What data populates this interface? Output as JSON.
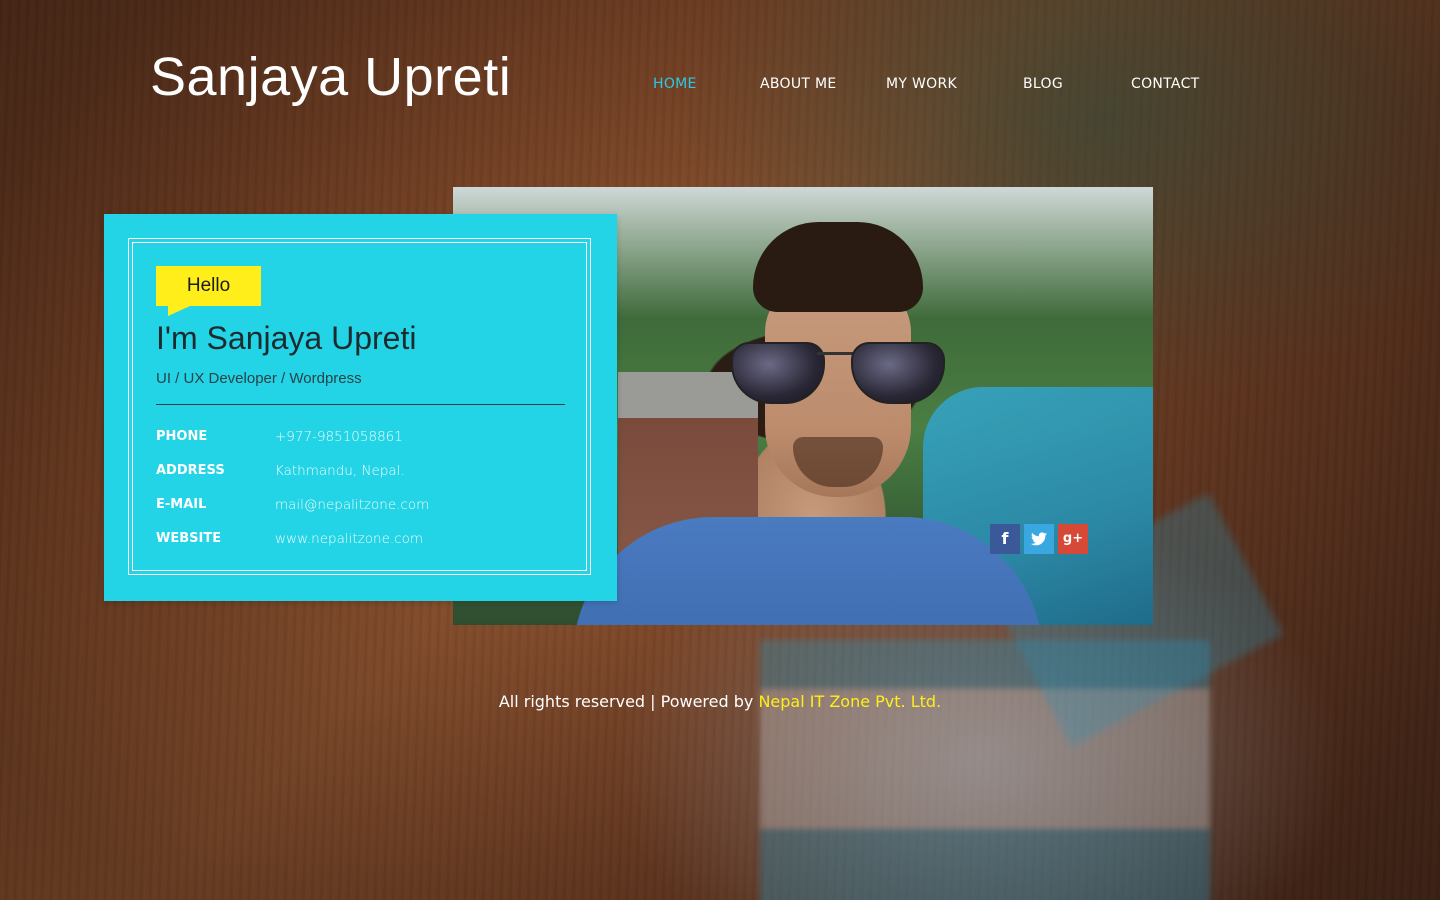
{
  "site": {
    "title": "Sanjaya Upreti"
  },
  "nav": {
    "items": [
      {
        "label": "HOME",
        "active": true
      },
      {
        "label": "ABOUT ME",
        "active": false
      },
      {
        "label": "MY WORK",
        "active": false
      },
      {
        "label": "BLOG",
        "active": false
      },
      {
        "label": "CONTACT",
        "active": false
      }
    ]
  },
  "profile": {
    "greeting": "Hello",
    "name": "I'm Sanjaya Upreti",
    "role": "UI / UX Developer / Wordpress",
    "info": [
      {
        "label": "PHONE",
        "value": "+977-9851058861"
      },
      {
        "label": "ADDRESS",
        "value": "Kathmandu, Nepal."
      },
      {
        "label": "E-MAIL",
        "value": "mail@nepalitzone.com"
      },
      {
        "label": "WEBSITE",
        "value": "www.nepalitzone.com"
      }
    ]
  },
  "social": {
    "facebook_glyph": "f",
    "twitter_glyph": "t",
    "googleplus_glyph": "g+"
  },
  "footer": {
    "text": "All rights reserved | Powered by ",
    "link_label": "Nepal IT Zone Pvt. Ltd."
  },
  "colors": {
    "accent": "#22d4e6",
    "nav_active": "#2ec9e2",
    "highlight": "#ffee1a",
    "facebook": "#3b5998",
    "twitter": "#3aa8e0",
    "googleplus": "#d64937"
  },
  "icons": {
    "facebook": "facebook-icon",
    "twitter": "twitter-icon",
    "googleplus": "google-plus-icon"
  }
}
